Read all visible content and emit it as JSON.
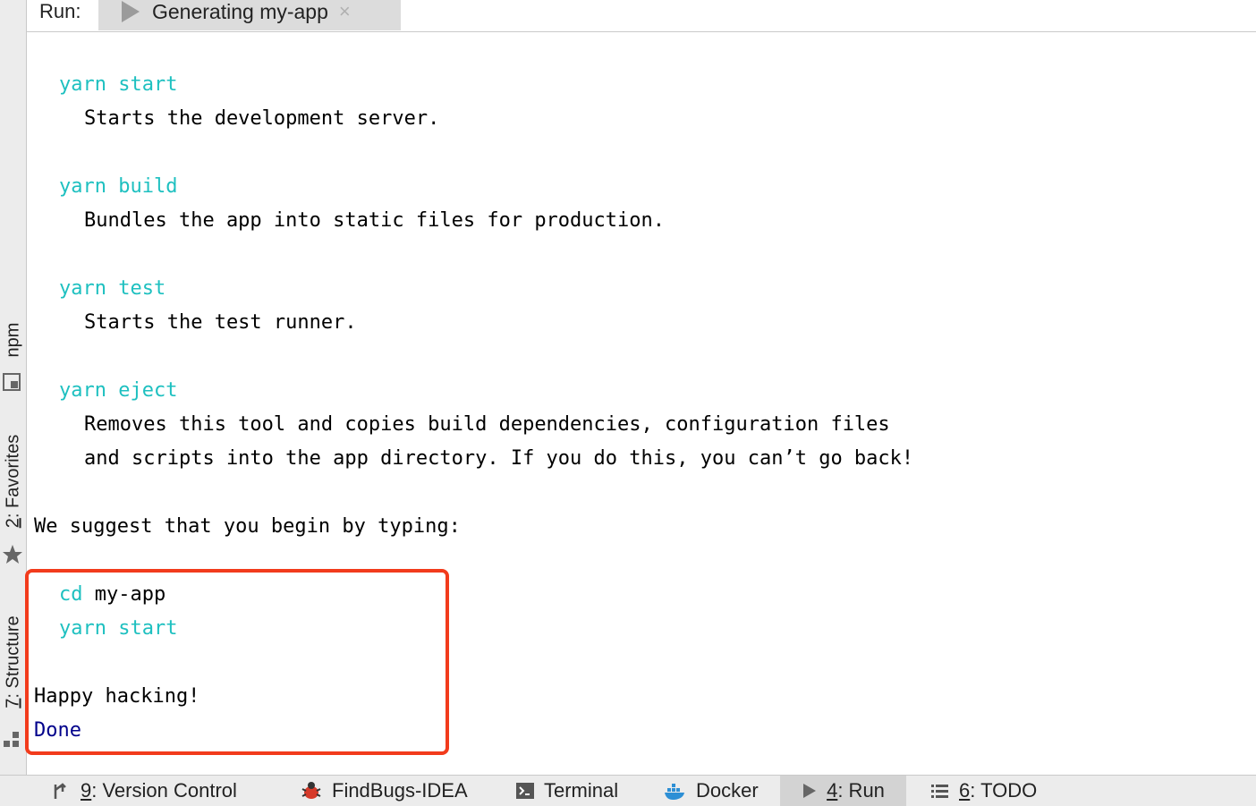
{
  "run_header": {
    "label": "Run:",
    "tab_title": "Generating my-app",
    "close_glyph": "×"
  },
  "left_strip": {
    "npm": "npm",
    "favorites_num": "2",
    "favorites_rest": ": Favorites",
    "structure_num": "7",
    "structure_rest": ": Structure"
  },
  "console": {
    "lines": [
      {
        "cmd": "yarn start",
        "text": ""
      },
      {
        "cmd": "",
        "text": "Starts the development server."
      },
      {
        "cmd": "yarn build",
        "text": ""
      },
      {
        "cmd": "",
        "text": "Bundles the app into static files for production."
      },
      {
        "cmd": "yarn test",
        "text": ""
      },
      {
        "cmd": "",
        "text": "Starts the test runner."
      },
      {
        "cmd": "yarn eject",
        "text": ""
      },
      {
        "cmd": "",
        "text": "Removes this tool and copies build dependencies, configuration files"
      },
      {
        "cmd": "",
        "text": "and scripts into the app directory. If you do this, you can’t go back!"
      },
      {
        "cmd": "",
        "text": "We suggest that you begin by typing:"
      },
      {
        "cmd": "cd",
        "text": " my-app"
      },
      {
        "cmd": "yarn start",
        "text": ""
      },
      {
        "cmd": "",
        "text": "Happy hacking!"
      },
      {
        "cmd": "",
        "text": "Done"
      }
    ]
  },
  "bottom_bar": {
    "version_control_num": "9",
    "version_control_rest": ": Version Control",
    "findbugs": "FindBugs-IDEA",
    "terminal": "Terminal",
    "docker": "Docker",
    "run_num": "4",
    "run_rest": ": Run",
    "todo_num": "6",
    "todo_rest": ": TODO"
  },
  "colors": {
    "command": "#1ec0c0",
    "done": "#00008b",
    "highlight_border": "#f23b1c"
  }
}
